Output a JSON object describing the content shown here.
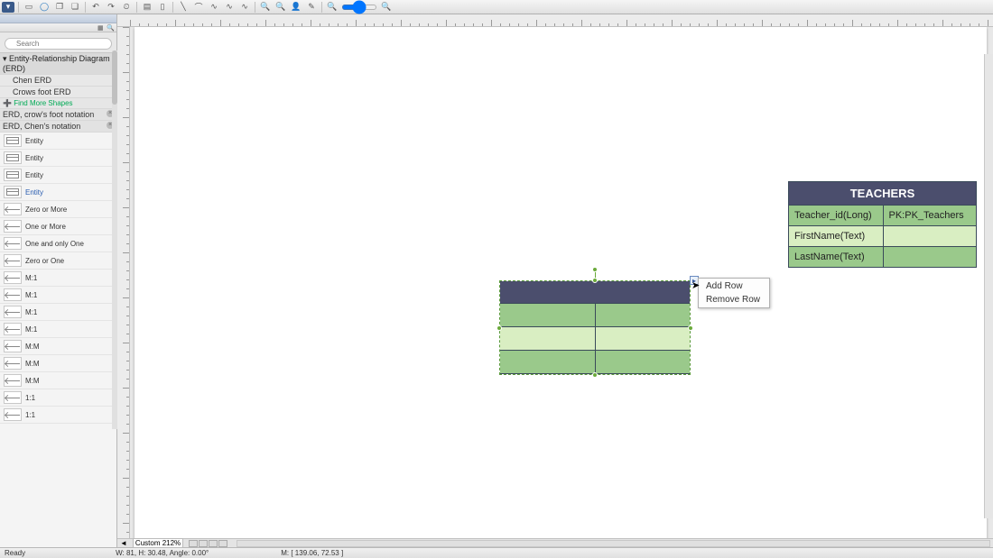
{
  "toolbar": {
    "buttons": [
      "new",
      "view",
      "globe",
      "copy",
      "paste",
      "undo",
      "redo",
      "line",
      "arc",
      "curve1",
      "curve2",
      "bezier",
      "zoomin",
      "zoomout",
      "user",
      "brush",
      "zoom",
      "magnify"
    ]
  },
  "sidebar": {
    "search_placeholder": "Search",
    "library_category": "Entity-Relationship Diagram (ERD)",
    "library_items": [
      "Chen ERD",
      "Crows foot ERD"
    ],
    "find_more": "Find More Shapes",
    "loaded_libs": [
      "ERD, crow's foot notation",
      "ERD, Chen's notation"
    ],
    "shapes": [
      {
        "label": "Entity",
        "sel": false
      },
      {
        "label": "Entity",
        "sel": false
      },
      {
        "label": "Entity",
        "sel": false
      },
      {
        "label": "Entity",
        "sel": true
      },
      {
        "label": "Zero or More",
        "sel": false
      },
      {
        "label": "One or More",
        "sel": false
      },
      {
        "label": "One and only One",
        "sel": false
      },
      {
        "label": "Zero or One",
        "sel": false
      },
      {
        "label": "M:1",
        "sel": false
      },
      {
        "label": "M:1",
        "sel": false
      },
      {
        "label": "M:1",
        "sel": false
      },
      {
        "label": "M:1",
        "sel": false
      },
      {
        "label": "M:M",
        "sel": false
      },
      {
        "label": "M:M",
        "sel": false
      },
      {
        "label": "M:M",
        "sel": false
      },
      {
        "label": "1:1",
        "sel": false
      },
      {
        "label": "1:1",
        "sel": false
      }
    ]
  },
  "erd_table": {
    "title": "TEACHERS",
    "rows": [
      {
        "c0": "Teacher_id(Long)",
        "c1": "PK:PK_Teachers"
      },
      {
        "c0": "FirstName(Text)",
        "c1": ""
      },
      {
        "c0": "LastName(Text)",
        "c1": ""
      }
    ]
  },
  "context_menu": {
    "items": [
      "Add Row",
      "Remove Row"
    ]
  },
  "bottombar": {
    "zoom": "Custom 212%"
  },
  "status": {
    "ready": "Ready",
    "dims": "W: 81, H: 30.48, Angle: 0.00°",
    "mouse": "M: [ 139.06, 72.53 ]"
  }
}
